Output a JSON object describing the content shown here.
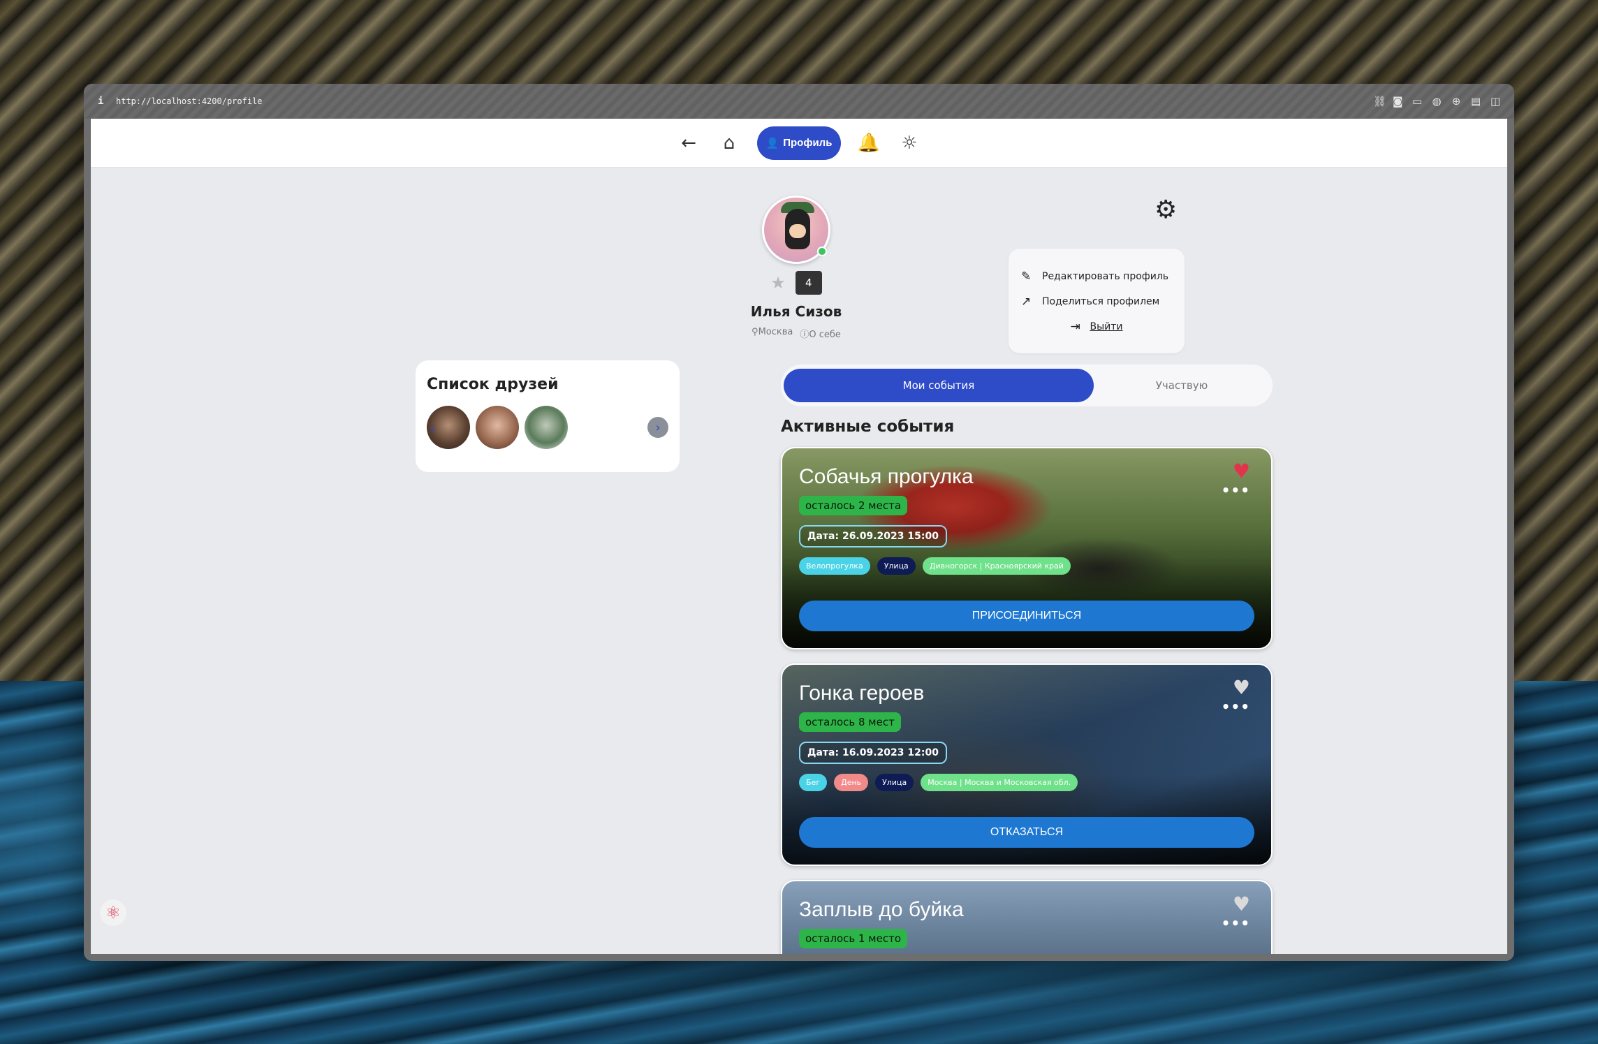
{
  "browser": {
    "url": "http://localhost:4200/profile",
    "info_icon": "info-icon",
    "tool_icons": [
      "link-icon",
      "camera-icon",
      "window-icon",
      "globe-icon",
      "target-icon",
      "reader-icon",
      "split-icon"
    ]
  },
  "nav": {
    "profile_label": "Профиль"
  },
  "profile": {
    "rating_count": "4",
    "name": "Илья Сизов",
    "city": "Москва",
    "about": "О себе"
  },
  "settings_menu": {
    "edit": "Редактировать профиль",
    "share": "Поделиться профилем",
    "logout": "Выйти"
  },
  "friends": {
    "title": "Список друзей",
    "items": [
      "friend-1",
      "friend-2",
      "friend-3"
    ]
  },
  "tabs": {
    "my_events": "Мои события",
    "participating": "Участвую"
  },
  "section": {
    "title": "Активные события"
  },
  "events": [
    {
      "title": "Собачья прогулка",
      "spots": "осталось 2 места",
      "date": "Дата: 26.09.2023 15:00",
      "tags": [
        "Велопрогулка",
        "Улица",
        "Дивногорск | Красноярский край"
      ],
      "action": "ПРИСОЕДИНИТЬСЯ",
      "liked": true
    },
    {
      "title": "Гонка героев",
      "spots": "осталось 8 мест",
      "date": "Дата: 16.09.2023 12:00",
      "tags": [
        "Бег",
        "День",
        "Улица",
        "Москва | Москва и Московская обл."
      ],
      "action": "ОТКАЗАТЬСЯ",
      "liked": false
    },
    {
      "title": "Заплыв до буйка",
      "spots": "осталось 1 место",
      "liked": false
    }
  ],
  "colors": {
    "accent": "#2e4bc8",
    "action_button": "#1e78d2",
    "spots_badge": "#2eb54a",
    "heart_active": "#e2334d"
  }
}
